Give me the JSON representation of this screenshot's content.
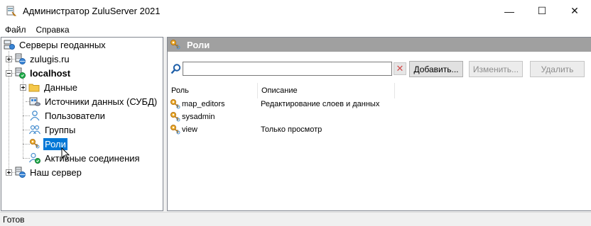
{
  "window": {
    "title": "Администратор ZuluServer 2021",
    "minimize_glyph": "—",
    "maximize_glyph": "☐",
    "close_glyph": "✕"
  },
  "menu": {
    "file": "Файл",
    "help": "Справка"
  },
  "tree": {
    "root": "Серверы геоданных",
    "servers": [
      {
        "label": "zulugis.ru",
        "expanded": false,
        "icon": "server-globe-icon"
      },
      {
        "label": "localhost",
        "expanded": true,
        "bold": true,
        "icon": "server-online-icon"
      },
      {
        "label": "Наш сервер",
        "expanded": false,
        "icon": "server-globe-icon"
      }
    ],
    "localhost_children": [
      {
        "label": "Данные",
        "icon": "folder-icon",
        "expandable": true
      },
      {
        "label": "Источники данных (СУБД)",
        "icon": "database-source-icon"
      },
      {
        "label": "Пользователи",
        "icon": "user-icon"
      },
      {
        "label": "Группы",
        "icon": "group-icon"
      },
      {
        "label": "Роли",
        "icon": "role-key-icon",
        "selected": true
      },
      {
        "label": "Активные соединения",
        "icon": "active-connection-icon"
      }
    ]
  },
  "panel": {
    "header": "Роли",
    "search_value": "",
    "buttons": {
      "add": "Добавить...",
      "edit": "Изменить...",
      "delete": "Удалить"
    },
    "columns": {
      "role": "Роль",
      "description": "Описание"
    },
    "rows": [
      {
        "role": "map_editors",
        "description": "Редактирование слоев и данных"
      },
      {
        "role": "sysadmin",
        "description": ""
      },
      {
        "role": "view",
        "description": "Только просмотр"
      }
    ]
  },
  "status": {
    "text": "Готов"
  },
  "colors": {
    "selection": "#0078d7",
    "panel_header": "#a0a0a0",
    "role_icon": "#e8a020"
  }
}
